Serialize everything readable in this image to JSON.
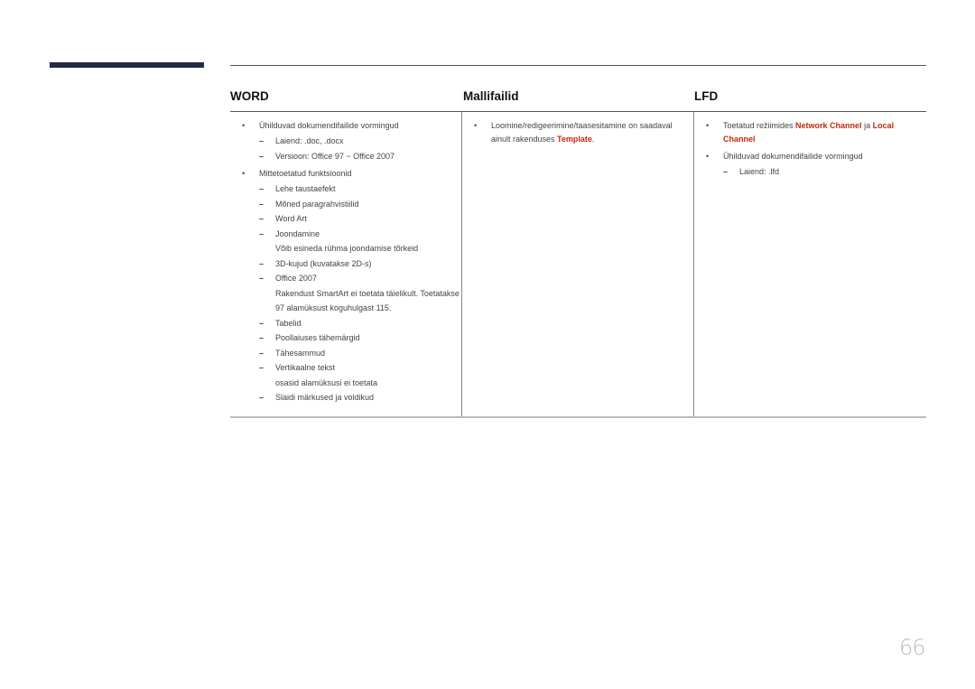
{
  "table": {
    "headers": [
      "WORD",
      "Mallifailid",
      "LFD"
    ],
    "word": {
      "items": [
        {
          "text": "Ühilduvad dokumendifailide vormingud",
          "sub": [
            {
              "text": "Laiend: .doc, .docx",
              "note": ""
            },
            {
              "text": "Versioon: Office 97 ~ Office 2007",
              "note": ""
            }
          ]
        },
        {
          "text": "Mittetoetatud funktsioonid",
          "sub": [
            {
              "text": "Lehe taustaefekt",
              "note": ""
            },
            {
              "text": "Mõned paragrahvistiilid",
              "note": ""
            },
            {
              "text": "Word Art",
              "note": ""
            },
            {
              "text": "Joondamine",
              "note": "Võib esineda rühma joondamise tõrkeid"
            },
            {
              "text": "3D-kujud (kuvatakse 2D-s)",
              "note": ""
            },
            {
              "text": "Office 2007",
              "note": "Rakendust SmartArt ei toetata täielikult. Toetatakse 97 alamüksust koguhulgast 115."
            },
            {
              "text": "Tabelid",
              "note": ""
            },
            {
              "text": "Poollaiuses tähemärgid",
              "note": ""
            },
            {
              "text": "Tähesammud",
              "note": ""
            },
            {
              "text": "Vertikaalne tekst",
              "note": "osasid alamüksusi ei toetata"
            },
            {
              "text": "Slaidi märkused ja voldikud",
              "note": ""
            }
          ]
        }
      ]
    },
    "mallifailid": {
      "item1": {
        "before": "Loomine/redigeerimine/taasesitamine on saadaval ainult rakenduses ",
        "highlight": "Template",
        "after": "."
      }
    },
    "lfd": {
      "item1": {
        "before": "Toetatud režiimides ",
        "highlight1": "Network Channel",
        "middle": " ja ",
        "highlight2": "Local Channel"
      },
      "item2": {
        "text": "Ühilduvad dokumendifailide vormingud",
        "sub": [
          "Laiend: .lfd"
        ]
      }
    }
  },
  "bullet_glyph": "•",
  "dash_glyph": "–",
  "highlight_color": "#c2290f",
  "page_number": "66"
}
